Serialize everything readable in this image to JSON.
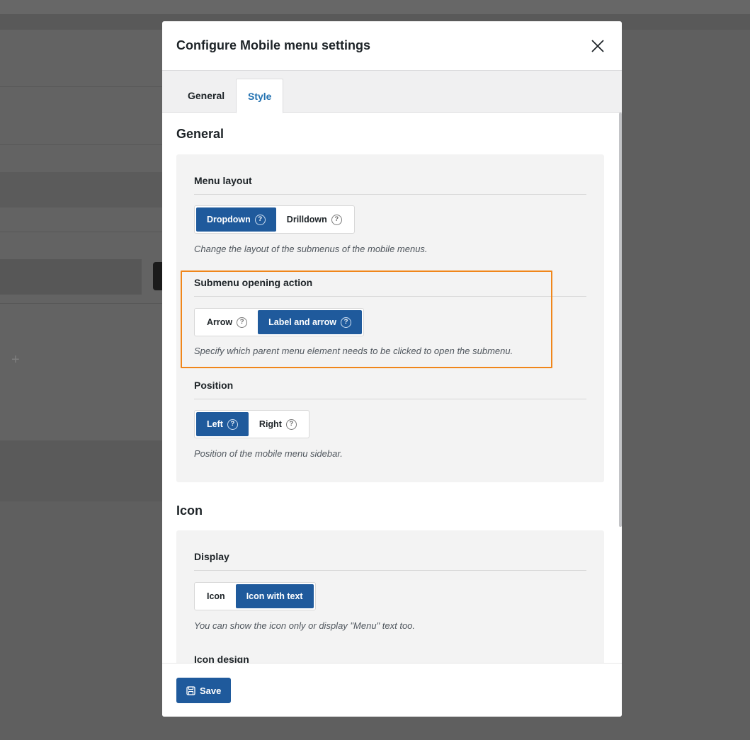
{
  "modal": {
    "title": "Configure Mobile menu settings",
    "close_icon": "close-icon"
  },
  "tabs": [
    {
      "label": "General",
      "active": false
    },
    {
      "label": "Style",
      "active": true
    }
  ],
  "sections": {
    "general": {
      "title": "General",
      "menu_layout": {
        "label": "Menu layout",
        "options": [
          {
            "label": "Dropdown",
            "selected": true,
            "icon": "help-icon"
          },
          {
            "label": "Drilldown",
            "selected": false,
            "icon": "help-icon"
          }
        ],
        "help": "Change the layout of the submenus of the mobile menus."
      },
      "submenu_action": {
        "label": "Submenu opening action",
        "options": [
          {
            "label": "Arrow",
            "selected": false,
            "icon": "help-icon"
          },
          {
            "label": "Label and arrow",
            "selected": true,
            "icon": "help-icon"
          }
        ],
        "help": "Specify which parent menu element needs to be clicked to open the submenu."
      },
      "position": {
        "label": "Position",
        "options": [
          {
            "label": "Left",
            "selected": true,
            "icon": "help-icon"
          },
          {
            "label": "Right",
            "selected": false,
            "icon": "help-icon"
          }
        ],
        "help": "Position of the mobile menu sidebar."
      }
    },
    "icon": {
      "title": "Icon",
      "display": {
        "label": "Display",
        "options": [
          {
            "label": "Icon",
            "selected": false
          },
          {
            "label": "Icon with text",
            "selected": true
          }
        ],
        "help": "You can show the icon only or display \"Menu\" text too."
      },
      "icon_design": {
        "label": "Icon design"
      }
    }
  },
  "footer": {
    "save_label": "Save",
    "save_icon": "save-icon"
  },
  "colors": {
    "primary": "#1f5a9c",
    "tab_active": "#2271b1",
    "highlight": "#f0861a",
    "overlay": "#5f5f5f"
  },
  "background": {
    "plus_symbol": "+"
  }
}
